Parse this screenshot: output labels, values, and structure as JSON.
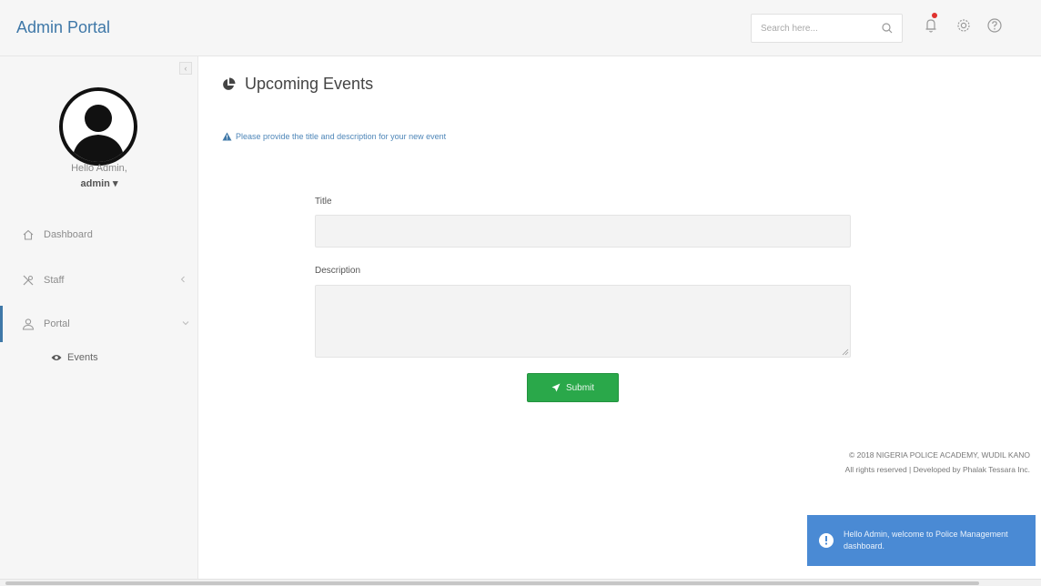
{
  "header": {
    "brand": "Admin Portal",
    "search_placeholder": "Search here..."
  },
  "sidebar": {
    "greeting": "Hello Admin,",
    "username": "admin ▾",
    "items": [
      {
        "label": "Dashboard",
        "icon": "home-icon"
      },
      {
        "label": "Staff",
        "icon": "tools-icon"
      },
      {
        "label": "Portal",
        "icon": "user-icon"
      }
    ],
    "sub_items": [
      {
        "label": "Events",
        "icon": "eye-icon"
      }
    ]
  },
  "main": {
    "title": "Upcoming Events",
    "notice": "Please provide the title and description for your new event",
    "title_label": "Title",
    "description_label": "Description",
    "submit_label": "Submit"
  },
  "footer": {
    "line1": "© 2018 NIGERIA POLICE ACADEMY, WUDIL KANO",
    "line2": "All rights reserved | Developed by Phalak Tessara Inc."
  },
  "toast": {
    "message": "Hello Admin, welcome to Police Management dashboard."
  },
  "colors": {
    "brand": "#3f78a8",
    "submit": "#2aa84a",
    "toast": "#4a8ad4",
    "notification_dot": "#e0322f"
  }
}
